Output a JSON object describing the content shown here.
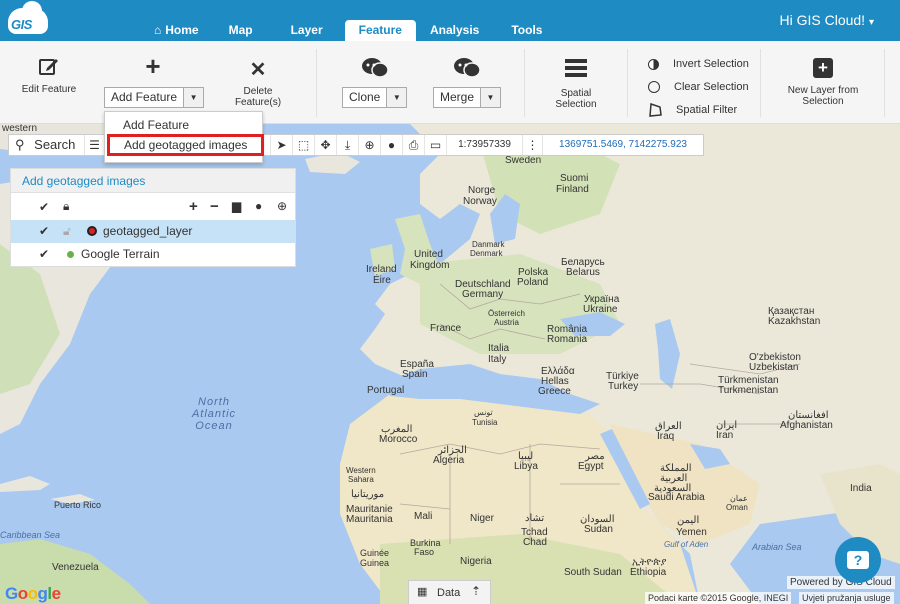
{
  "app": {
    "logo_text": "GIS",
    "user_menu": "Hi GIS Cloud!",
    "caret": "▾"
  },
  "nav": {
    "tabs": [
      "Home",
      "Map",
      "Layer",
      "Feature",
      "Analysis",
      "Tools"
    ],
    "active": "Feature"
  },
  "ribbon": {
    "edit_feature": "Edit Feature",
    "add_feature": "Add Feature",
    "delete_features_line1": "Delete",
    "delete_features_line2": "Feature(s)",
    "clone": "Clone",
    "merge": "Merge",
    "spatial_selection_line1": "Spatial",
    "spatial_selection_line2": "Selection",
    "invert_selection": "Invert Selection",
    "clear_selection": "Clear Selection",
    "spatial_filter": "Spatial Filter",
    "new_layer_line1": "New Layer from",
    "new_layer_line2": "Selection"
  },
  "dropdown": {
    "items": [
      "Add Feature",
      "Add geotagged images"
    ]
  },
  "map_toolbar": {
    "search_label": "Search",
    "scale": "1:73957339",
    "coords": "1369751.5469, 7142275.923"
  },
  "layer_panel": {
    "title": "Add geotagged images",
    "layers": [
      {
        "name": "geotagged_layer",
        "selected": true
      },
      {
        "name": "Google Terrain",
        "selected": false
      }
    ]
  },
  "map_labels": {
    "western": "western",
    "sweden": "Sweden",
    "suomi": "Suomi",
    "finland": "Finland",
    "norge": "Norge",
    "norway": "Norway",
    "danmark": "Danmark",
    "denmark": "Denmark",
    "united": "United",
    "kingdom": "Kingdom",
    "ireland": "Ireland",
    "eire": "Éire",
    "belarus_local": "Беларусь",
    "belarus": "Belarus",
    "polska": "Polska",
    "poland": "Poland",
    "deutschland": "Deutschland",
    "germany": "Germany",
    "ukraina": "Україна",
    "ukraine": "Ukraine",
    "osterreich": "Österreich",
    "austria": "Austria",
    "france": "France",
    "romania_local": "România",
    "romania": "Romania",
    "italia": "Italia",
    "italy": "Italy",
    "kazakhstan_local": "Қазақстан",
    "kazakhstan": "Kazakhstan",
    "espana": "España",
    "spain": "Spain",
    "portugal": "Portugal",
    "ellada": "Ελλάδα",
    "hellas": "Hellas",
    "greece": "Greece",
    "turkiye": "Türkiye",
    "turkey": "Turkey",
    "uzbekiston": "O'zbekiston",
    "uzbekistan": "Uzbekistan",
    "turkmenistan1": "Türkmenistan",
    "turkmenistan2": "Turkmenistan",
    "tunisia_ar": "تونس",
    "tunisia": "Tunisia",
    "iraq_ar": "العراق",
    "iraq": "Iraq",
    "iran_fa": "ایران",
    "iran": "Iran",
    "afghanistan_fa": "افغانستان",
    "afghanistan": "Afghanistan",
    "morocco_ar": "المغرب",
    "morocco": "Morocco",
    "algeria_ar": "الجزائر",
    "algeria": "Algeria",
    "libya_ar": "ليبيا",
    "libya": "Libya",
    "egypt_ar": "مصر",
    "egypt": "Egypt",
    "north_atlantic_1": "North",
    "north_atlantic_2": "Atlantic",
    "north_atlantic_3": "Ocean",
    "western_sahara_1": "Western",
    "western_sahara_2": "Sahara",
    "saudi_ar_1": "المملكة",
    "saudi_ar_2": "العربية",
    "saudi_ar_3": "السعودية",
    "saudi": "Saudi Arabia",
    "oman_ar": "عمان",
    "oman": "Oman",
    "india": "India",
    "mauritania_ar": "موريتانيا",
    "mauritania1": "Mauritanie",
    "mauritania2": "Mauritania",
    "mali": "Mali",
    "niger": "Niger",
    "chad_ar": "تشاد",
    "chad1": "Tchad",
    "chad2": "Chad",
    "sudan_ar": "السودان",
    "sudan": "Sudan",
    "yemen_ar": "اليمن",
    "yemen": "Yemen",
    "gulf_aden": "Gulf of Aden",
    "arabian_sea": "Arabian Sea",
    "puerto_rico": "Puerto Rico",
    "caribbean": "Caribbean Sea",
    "venezuela": "Venezuela",
    "burkina1": "Burkina",
    "burkina2": "Faso",
    "guinee": "Guinée",
    "guinea": "Guinea",
    "nigeria": "Nigeria",
    "south_sudan": "South Sudan",
    "ethiopia_am": "ኢትዮጵያ",
    "ethiopia": "Ethiopia"
  },
  "bottom": {
    "data_tab": "Data",
    "powered_by": "Powered by GIS Cloud",
    "map_data": "Podaci karte ©2015 Google, INEGI",
    "terms": "Uvjeti pružanja usluge",
    "google": "Google"
  },
  "chat_label": "?"
}
